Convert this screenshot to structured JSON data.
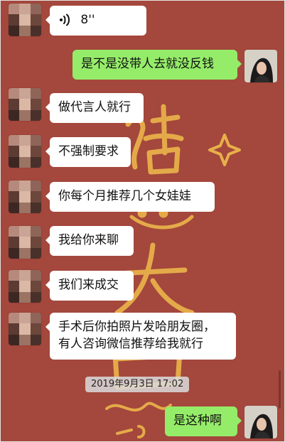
{
  "chat": {
    "voice_message": {
      "duration": "8''"
    },
    "messages": [
      {
        "side": "out",
        "text": "是不是没带人去就没反钱"
      },
      {
        "side": "in",
        "text": "做代言人就行"
      },
      {
        "side": "in",
        "text": "不强制要求"
      },
      {
        "side": "in",
        "text": "你每个月推荐几个女娃娃"
      },
      {
        "side": "in",
        "text": "我给你来聊"
      },
      {
        "side": "in",
        "text": "我们来成交"
      },
      {
        "side": "in",
        "line1": "手术后你拍照片发哈朋友圈，",
        "line2": "有人咨询微信推荐给我就行"
      },
      {
        "side": "out",
        "text": "是这种啊"
      }
    ],
    "timestamp": "2019年9月3日 17:02"
  },
  "colors": {
    "background": "#a4473c",
    "incoming_bubble": "#ffffff",
    "outgoing_bubble": "#95ec69",
    "wallpaper_lettering": "#e8b04a"
  },
  "icons": {
    "voice": "voice-wave-icon",
    "sparkle": "sparkle-icon"
  }
}
